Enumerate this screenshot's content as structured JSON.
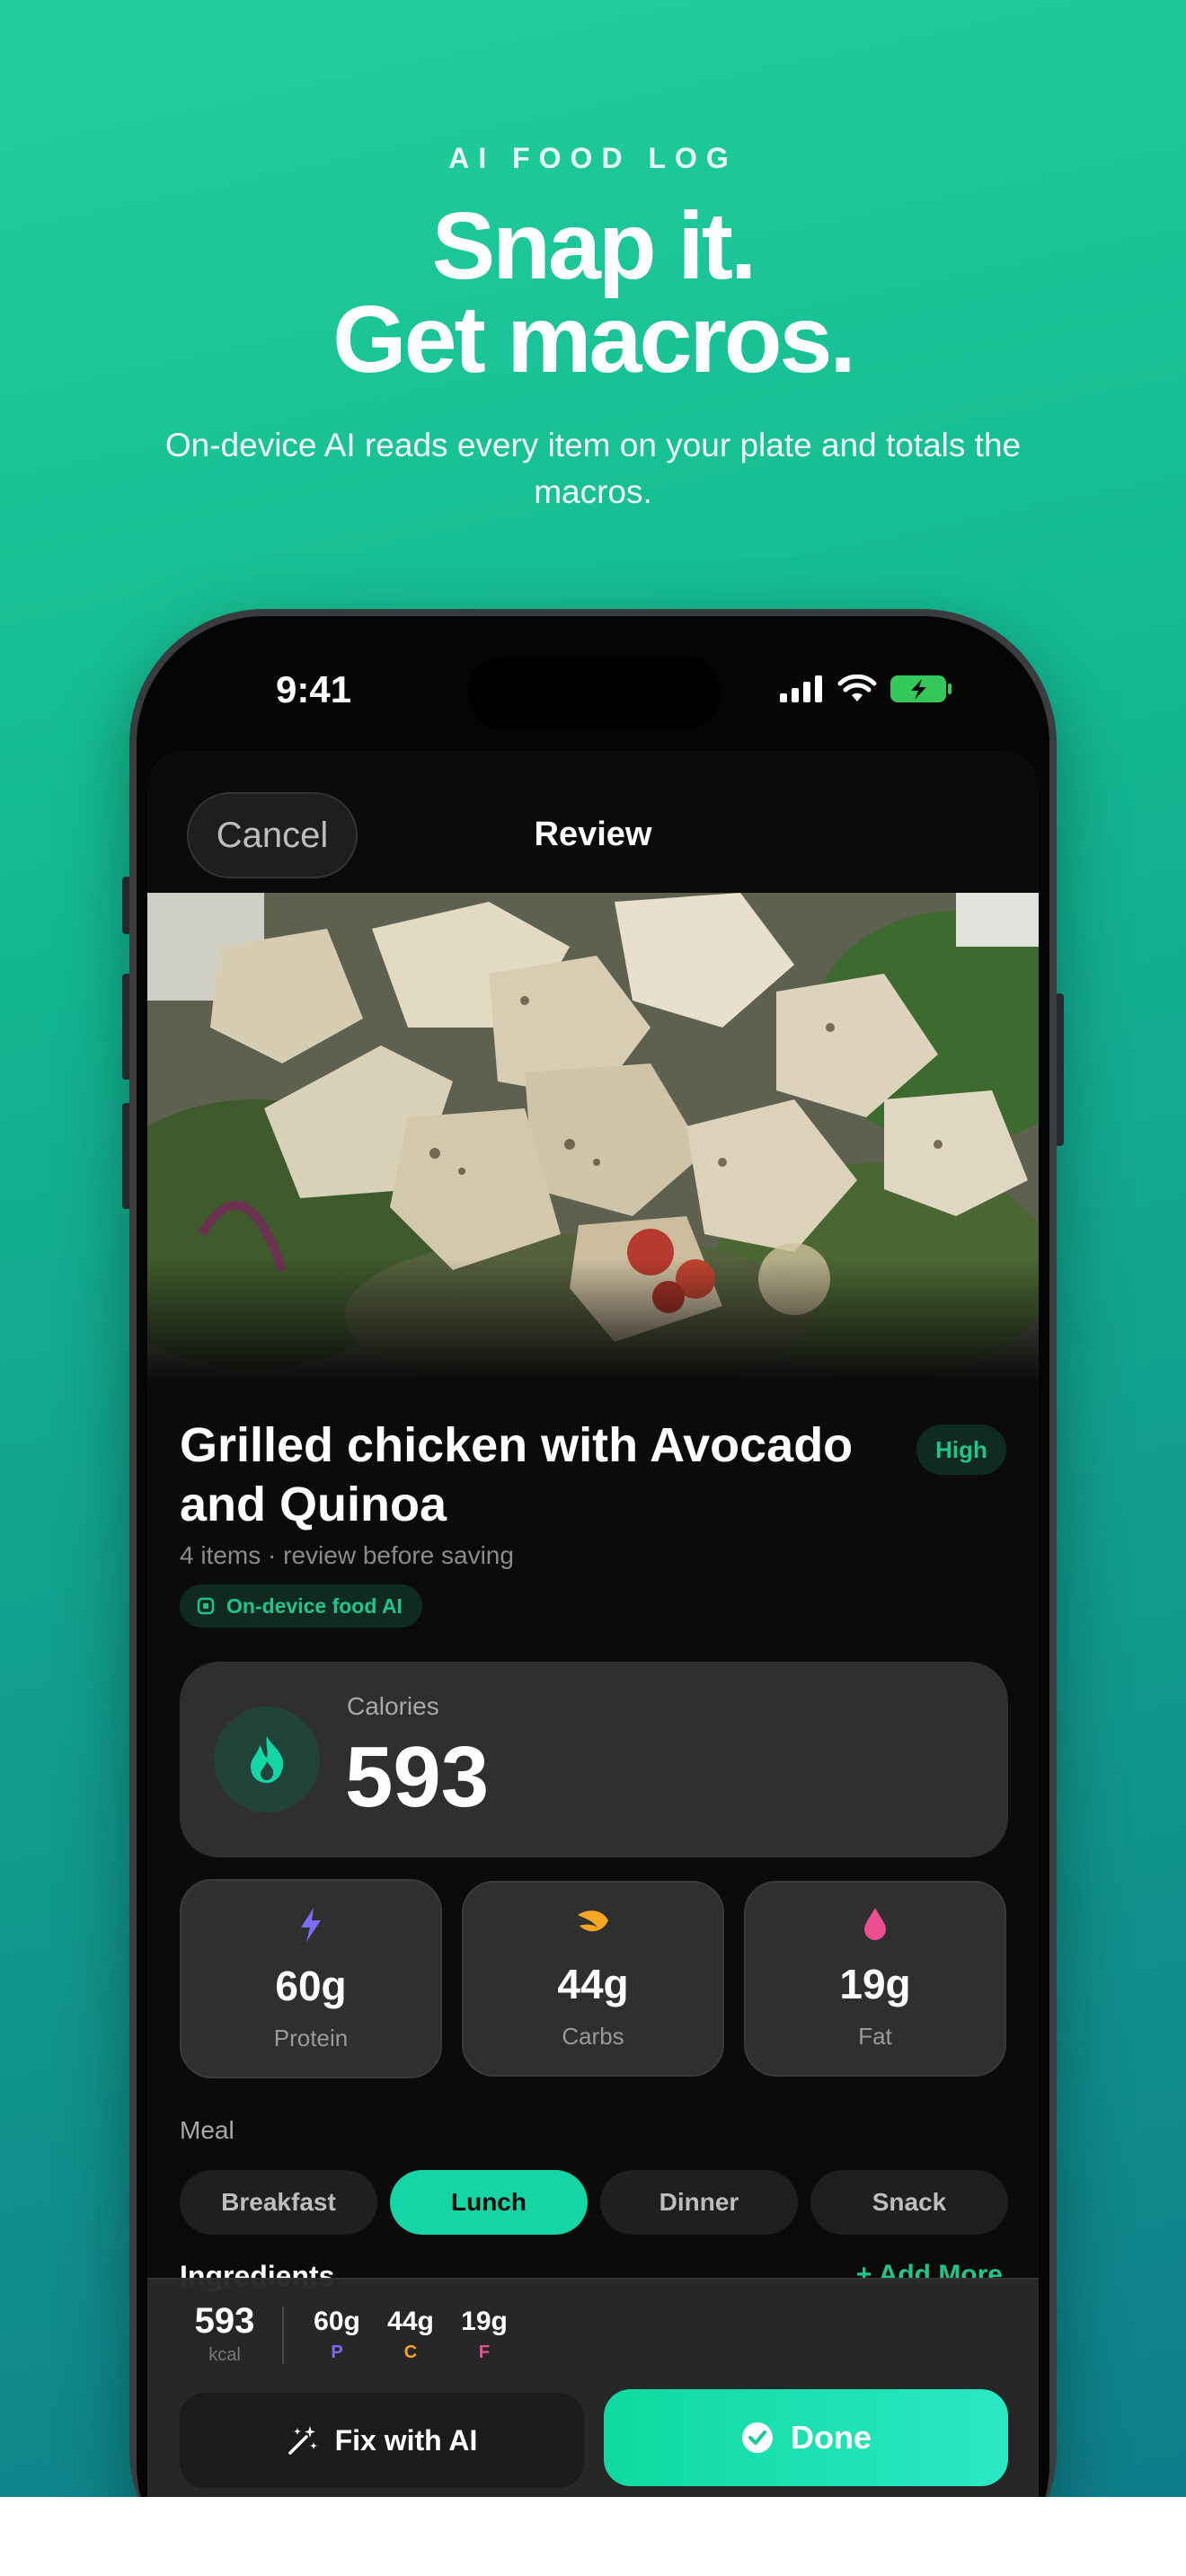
{
  "marketing": {
    "eyebrow": "AI FOOD LOG",
    "headline_line1": "Snap it.",
    "headline_line2": "Get macros.",
    "subhead": "On-device AI reads every item on your plate and totals the macros."
  },
  "status_bar": {
    "time": "9:41",
    "icons": [
      "signal-icon",
      "wifi-icon",
      "battery-charging-icon"
    ]
  },
  "nav": {
    "cancel_label": "Cancel",
    "title": "Review"
  },
  "food": {
    "photo_alt": "",
    "title": "Grilled chicken with Avocado and Quinoa",
    "confidence": "High",
    "subtitle": "4 items · review before saving",
    "ai_chip": "On-device food AI"
  },
  "calories": {
    "label": "Calories",
    "value": "593",
    "icon": "flame-icon"
  },
  "macros": [
    {
      "value": "60g",
      "label": "Protein",
      "icon": "bolt-icon",
      "color": "#7b6cf6"
    },
    {
      "value": "44g",
      "label": "Carbs",
      "icon": "leaf-icon",
      "color": "#f5a623"
    },
    {
      "value": "19g",
      "label": "Fat",
      "icon": "drop-icon",
      "color": "#ec4f8f"
    }
  ],
  "meal": {
    "label": "Meal",
    "options": [
      "Breakfast",
      "Lunch",
      "Dinner",
      "Snack"
    ],
    "selected": "Lunch"
  },
  "ingredients_peek": {
    "heading": "Ingredients",
    "add_label": "+ Add More"
  },
  "summary": {
    "kcal_value": "593",
    "kcal_unit": "kcal",
    "protein": {
      "value": "60g",
      "letter": "P",
      "color": "#7b6cf6"
    },
    "carbs": {
      "value": "44g",
      "letter": "C",
      "color": "#f5a623"
    },
    "fat": {
      "value": "19g",
      "letter": "F",
      "color": "#ec4f8f"
    }
  },
  "actions": {
    "fix_label": "Fix with AI",
    "done_label": "Done"
  },
  "colors": {
    "accent": "#14d6a4",
    "background_top": "#22cf9c",
    "background_bottom": "#0e7e8a"
  }
}
